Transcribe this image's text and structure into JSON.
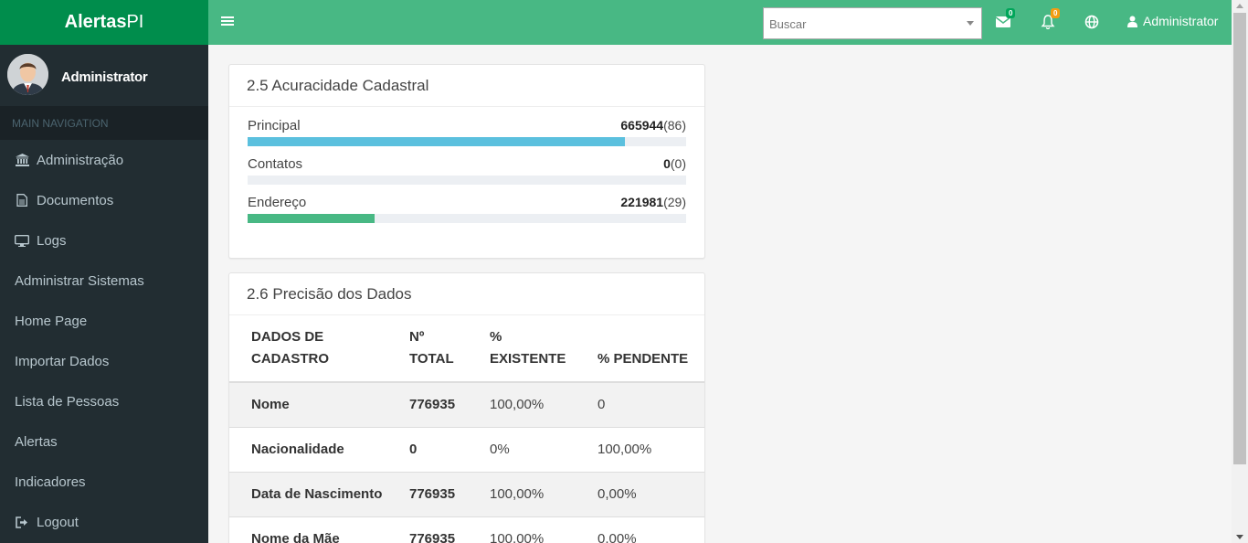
{
  "brand": {
    "bold": "Alertas",
    "light": "PI"
  },
  "topbar": {
    "search_placeholder": "Buscar",
    "mail_badge": "0",
    "bell_badge": "0",
    "user": "Administrator",
    "mail_badge_color": "#00a65a",
    "bell_badge_color": "#f39c12"
  },
  "sidebar": {
    "user": "Administrator",
    "header": "MAIN NAVIGATION",
    "items": [
      {
        "label": "Administração",
        "icon": "bank-icon"
      },
      {
        "label": "Documentos",
        "icon": "file-icon"
      },
      {
        "label": "Logs",
        "icon": "desktop-icon"
      },
      {
        "label": "Administrar Sistemas",
        "icon": ""
      },
      {
        "label": "Home Page",
        "icon": ""
      },
      {
        "label": "Importar Dados",
        "icon": ""
      },
      {
        "label": "Lista de Pessoas",
        "icon": ""
      },
      {
        "label": "Alertas",
        "icon": ""
      },
      {
        "label": "Indicadores",
        "icon": ""
      },
      {
        "label": "Logout",
        "icon": "sign-out-icon"
      }
    ]
  },
  "acuracidade": {
    "title": "2.5 Acuracidade Cadastral",
    "rows": [
      {
        "label": "Principal",
        "value": "665944",
        "pct": "(86)",
        "fill": 86,
        "color": "#5bc0de"
      },
      {
        "label": "Contatos",
        "value": "0",
        "pct": "(0)",
        "fill": 0,
        "color": "#5bc0de"
      },
      {
        "label": "Endereço",
        "value": "221981",
        "pct": "(29)",
        "fill": 29,
        "color": "#48b884"
      }
    ]
  },
  "precisao": {
    "title": "2.6 Precisão dos Dados",
    "headers": [
      "DADOS DE CADASTRO",
      "Nº TOTAL",
      "% EXISTENTE",
      "% PENDENTE"
    ],
    "rows": [
      [
        "Nome",
        "776935",
        "100,00%",
        "0"
      ],
      [
        "Nacionalidade",
        "0",
        "0%",
        "100,00%"
      ],
      [
        "Data de Nascimento",
        "776935",
        "100,00%",
        "0,00%"
      ],
      [
        "Nome da Mãe",
        "776935",
        "100,00%",
        "0,00%"
      ]
    ]
  }
}
